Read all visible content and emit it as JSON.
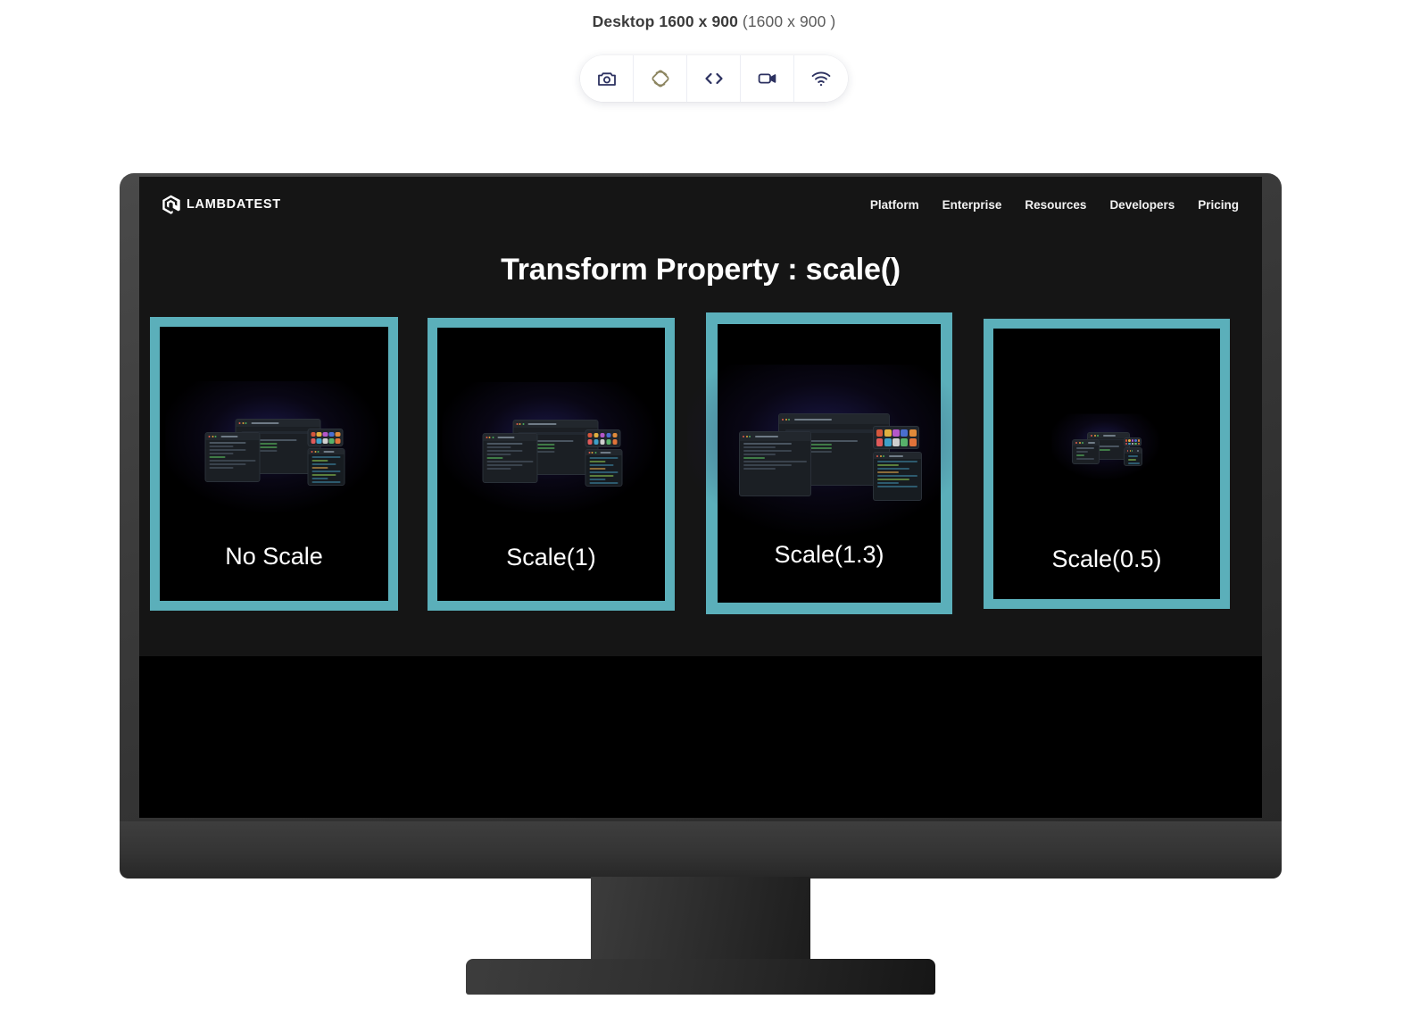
{
  "caption": {
    "device_label": "Desktop 1600 x 900",
    "resolution": "(1600 x 900 )"
  },
  "toolbar": {
    "buttons": [
      {
        "name": "camera-icon",
        "label": "Screenshot"
      },
      {
        "name": "screen-rotation-icon",
        "label": "Rotate"
      },
      {
        "name": "code-icon",
        "label": "Inspect"
      },
      {
        "name": "video-icon",
        "label": "Record"
      },
      {
        "name": "wifi-icon",
        "label": "Network"
      }
    ],
    "colors": {
      "active": "#2c3160",
      "disabled": "#8c8560",
      "background": "#ffffff"
    }
  },
  "site": {
    "brand": "LAMBDATEST",
    "brand_icon": "lambdatest-logo-icon",
    "nav": [
      {
        "label": "Platform"
      },
      {
        "label": "Enterprise"
      },
      {
        "label": "Resources"
      },
      {
        "label": "Developers"
      },
      {
        "label": "Pricing"
      }
    ],
    "title": "Transform Property : scale()",
    "background": "#151515",
    "accent": "#5bafba"
  },
  "cards": [
    {
      "label": "No Scale",
      "scale": 1,
      "border_color": "#5bafba"
    },
    {
      "label": "Scale(1)",
      "scale": 1,
      "border_color": "#5bafba"
    },
    {
      "label": "Scale(1.3)",
      "scale": 1.3,
      "border_color": "#5bafba"
    },
    {
      "label": "Scale(0.5)",
      "scale": 0.5,
      "border_color": "#5bafba"
    }
  ],
  "thumbnail": {
    "alt": "HyperExecute dashboard composite screenshot",
    "windows": [
      {
        "name": "hyperexecute-dashboard-window",
        "title": "HyperExecute"
      },
      {
        "name": "terminal-window",
        "title": "HyperExecute CLI"
      },
      {
        "name": "browser-grid-window",
        "title": "Browser Icons"
      },
      {
        "name": "yaml-code-window",
        "title": "hyperexecute.yaml"
      }
    ]
  },
  "monitor": {
    "frame_color": "#3a3a3a",
    "screen_color": "#000000"
  }
}
